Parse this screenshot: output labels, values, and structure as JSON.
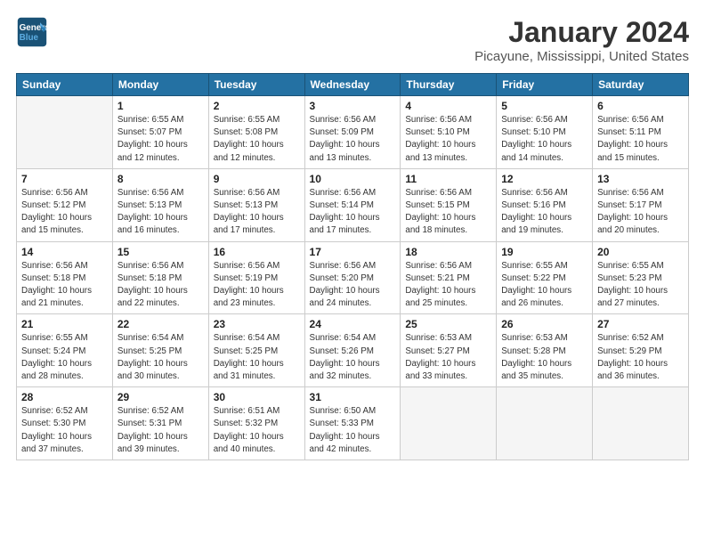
{
  "logo": {
    "line1": "General",
    "line2": "Blue"
  },
  "header": {
    "title": "January 2024",
    "subtitle": "Picayune, Mississippi, United States"
  },
  "weekdays": [
    "Sunday",
    "Monday",
    "Tuesday",
    "Wednesday",
    "Thursday",
    "Friday",
    "Saturday"
  ],
  "weeks": [
    [
      {
        "day": "",
        "sunrise": "",
        "sunset": "",
        "daylight": ""
      },
      {
        "day": "1",
        "sunrise": "Sunrise: 6:55 AM",
        "sunset": "Sunset: 5:07 PM",
        "daylight": "Daylight: 10 hours and 12 minutes."
      },
      {
        "day": "2",
        "sunrise": "Sunrise: 6:55 AM",
        "sunset": "Sunset: 5:08 PM",
        "daylight": "Daylight: 10 hours and 12 minutes."
      },
      {
        "day": "3",
        "sunrise": "Sunrise: 6:56 AM",
        "sunset": "Sunset: 5:09 PM",
        "daylight": "Daylight: 10 hours and 13 minutes."
      },
      {
        "day": "4",
        "sunrise": "Sunrise: 6:56 AM",
        "sunset": "Sunset: 5:10 PM",
        "daylight": "Daylight: 10 hours and 13 minutes."
      },
      {
        "day": "5",
        "sunrise": "Sunrise: 6:56 AM",
        "sunset": "Sunset: 5:10 PM",
        "daylight": "Daylight: 10 hours and 14 minutes."
      },
      {
        "day": "6",
        "sunrise": "Sunrise: 6:56 AM",
        "sunset": "Sunset: 5:11 PM",
        "daylight": "Daylight: 10 hours and 15 minutes."
      }
    ],
    [
      {
        "day": "7",
        "sunrise": "Sunrise: 6:56 AM",
        "sunset": "Sunset: 5:12 PM",
        "daylight": "Daylight: 10 hours and 15 minutes."
      },
      {
        "day": "8",
        "sunrise": "Sunrise: 6:56 AM",
        "sunset": "Sunset: 5:13 PM",
        "daylight": "Daylight: 10 hours and 16 minutes."
      },
      {
        "day": "9",
        "sunrise": "Sunrise: 6:56 AM",
        "sunset": "Sunset: 5:13 PM",
        "daylight": "Daylight: 10 hours and 17 minutes."
      },
      {
        "day": "10",
        "sunrise": "Sunrise: 6:56 AM",
        "sunset": "Sunset: 5:14 PM",
        "daylight": "Daylight: 10 hours and 17 minutes."
      },
      {
        "day": "11",
        "sunrise": "Sunrise: 6:56 AM",
        "sunset": "Sunset: 5:15 PM",
        "daylight": "Daylight: 10 hours and 18 minutes."
      },
      {
        "day": "12",
        "sunrise": "Sunrise: 6:56 AM",
        "sunset": "Sunset: 5:16 PM",
        "daylight": "Daylight: 10 hours and 19 minutes."
      },
      {
        "day": "13",
        "sunrise": "Sunrise: 6:56 AM",
        "sunset": "Sunset: 5:17 PM",
        "daylight": "Daylight: 10 hours and 20 minutes."
      }
    ],
    [
      {
        "day": "14",
        "sunrise": "Sunrise: 6:56 AM",
        "sunset": "Sunset: 5:18 PM",
        "daylight": "Daylight: 10 hours and 21 minutes."
      },
      {
        "day": "15",
        "sunrise": "Sunrise: 6:56 AM",
        "sunset": "Sunset: 5:18 PM",
        "daylight": "Daylight: 10 hours and 22 minutes."
      },
      {
        "day": "16",
        "sunrise": "Sunrise: 6:56 AM",
        "sunset": "Sunset: 5:19 PM",
        "daylight": "Daylight: 10 hours and 23 minutes."
      },
      {
        "day": "17",
        "sunrise": "Sunrise: 6:56 AM",
        "sunset": "Sunset: 5:20 PM",
        "daylight": "Daylight: 10 hours and 24 minutes."
      },
      {
        "day": "18",
        "sunrise": "Sunrise: 6:56 AM",
        "sunset": "Sunset: 5:21 PM",
        "daylight": "Daylight: 10 hours and 25 minutes."
      },
      {
        "day": "19",
        "sunrise": "Sunrise: 6:55 AM",
        "sunset": "Sunset: 5:22 PM",
        "daylight": "Daylight: 10 hours and 26 minutes."
      },
      {
        "day": "20",
        "sunrise": "Sunrise: 6:55 AM",
        "sunset": "Sunset: 5:23 PM",
        "daylight": "Daylight: 10 hours and 27 minutes."
      }
    ],
    [
      {
        "day": "21",
        "sunrise": "Sunrise: 6:55 AM",
        "sunset": "Sunset: 5:24 PM",
        "daylight": "Daylight: 10 hours and 28 minutes."
      },
      {
        "day": "22",
        "sunrise": "Sunrise: 6:54 AM",
        "sunset": "Sunset: 5:25 PM",
        "daylight": "Daylight: 10 hours and 30 minutes."
      },
      {
        "day": "23",
        "sunrise": "Sunrise: 6:54 AM",
        "sunset": "Sunset: 5:25 PM",
        "daylight": "Daylight: 10 hours and 31 minutes."
      },
      {
        "day": "24",
        "sunrise": "Sunrise: 6:54 AM",
        "sunset": "Sunset: 5:26 PM",
        "daylight": "Daylight: 10 hours and 32 minutes."
      },
      {
        "day": "25",
        "sunrise": "Sunrise: 6:53 AM",
        "sunset": "Sunset: 5:27 PM",
        "daylight": "Daylight: 10 hours and 33 minutes."
      },
      {
        "day": "26",
        "sunrise": "Sunrise: 6:53 AM",
        "sunset": "Sunset: 5:28 PM",
        "daylight": "Daylight: 10 hours and 35 minutes."
      },
      {
        "day": "27",
        "sunrise": "Sunrise: 6:52 AM",
        "sunset": "Sunset: 5:29 PM",
        "daylight": "Daylight: 10 hours and 36 minutes."
      }
    ],
    [
      {
        "day": "28",
        "sunrise": "Sunrise: 6:52 AM",
        "sunset": "Sunset: 5:30 PM",
        "daylight": "Daylight: 10 hours and 37 minutes."
      },
      {
        "day": "29",
        "sunrise": "Sunrise: 6:52 AM",
        "sunset": "Sunset: 5:31 PM",
        "daylight": "Daylight: 10 hours and 39 minutes."
      },
      {
        "day": "30",
        "sunrise": "Sunrise: 6:51 AM",
        "sunset": "Sunset: 5:32 PM",
        "daylight": "Daylight: 10 hours and 40 minutes."
      },
      {
        "day": "31",
        "sunrise": "Sunrise: 6:50 AM",
        "sunset": "Sunset: 5:33 PM",
        "daylight": "Daylight: 10 hours and 42 minutes."
      },
      {
        "day": "",
        "sunrise": "",
        "sunset": "",
        "daylight": ""
      },
      {
        "day": "",
        "sunrise": "",
        "sunset": "",
        "daylight": ""
      },
      {
        "day": "",
        "sunrise": "",
        "sunset": "",
        "daylight": ""
      }
    ]
  ]
}
